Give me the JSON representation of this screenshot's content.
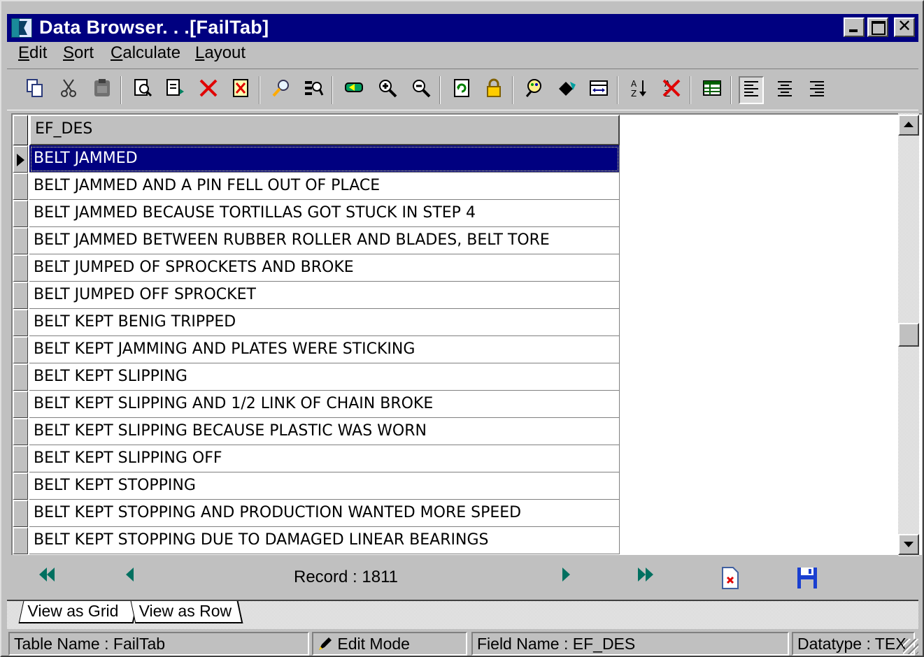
{
  "window": {
    "title": "Data Browser. . .[FailTab]",
    "controls": {
      "minimize": "minimize",
      "maximize": "maximize",
      "close": "✕"
    }
  },
  "menu": [
    {
      "label": "Edit",
      "accel": "E",
      "rest": "dit"
    },
    {
      "label": "Sort",
      "accel": "S",
      "rest": "ort"
    },
    {
      "label": "Calculate",
      "accel": "C",
      "rest": "alculate"
    },
    {
      "label": "Layout",
      "accel": "L",
      "rest": "ayout"
    }
  ],
  "toolbar": {
    "icons": [
      "copy-icon",
      "cut-icon",
      "paste-icon",
      "find-record-icon",
      "edit-record-icon",
      "delete-icon",
      "delete-record-icon",
      "search-icon",
      "find-replace-icon",
      "go-to-icon",
      "zoom-in-icon",
      "zoom-out-icon",
      "refresh-icon",
      "lock-icon",
      "filter-icon",
      "paint-icon",
      "fit-columns-icon",
      "sort-az-icon",
      "clear-sort-icon",
      "grid-lines-icon",
      "align-left-icon",
      "align-center-icon",
      "align-right-icon"
    ],
    "pressed": "align-left-icon"
  },
  "grid": {
    "column_header": "EF_DES",
    "selected_index": 0,
    "rows": [
      "BELT JAMMED",
      "BELT JAMMED AND A PIN FELL OUT OF PLACE",
      "BELT JAMMED BECAUSE TORTILLAS GOT STUCK IN STEP 4",
      "BELT JAMMED BETWEEN RUBBER ROLLER AND BLADES, BELT TORE",
      "BELT JUMPED OF SPROCKETS AND BROKE",
      "BELT JUMPED OFF SPROCKET",
      "BELT KEPT BENIG TRIPPED",
      "BELT KEPT JAMMING AND PLATES WERE STICKING",
      "BELT KEPT SLIPPING",
      "BELT KEPT SLIPPING AND 1/2 LINK OF CHAIN BROKE",
      "BELT KEPT SLIPPING BECAUSE PLASTIC WAS WORN",
      "BELT KEPT SLIPPING OFF",
      "BELT KEPT STOPPING",
      "BELT KEPT STOPPING AND PRODUCTION WANTED MORE SPEED",
      "BELT KEPT STOPPING DUE TO DAMAGED LINEAR BEARINGS"
    ]
  },
  "navigation": {
    "record_label": "Record : 1811"
  },
  "tabs": [
    {
      "label": "View as Grid",
      "active": true
    },
    {
      "label": "View as Row",
      "active": false
    }
  ],
  "status": {
    "table": "Table Name : FailTab",
    "mode": "Edit Mode",
    "field": "Field Name : EF_DES",
    "datatype": "Datatype : TEX"
  },
  "colors": {
    "title_bar": "#000080",
    "selection": "#000080",
    "nav_arrows": "#007060",
    "face": "#c0c0c0"
  }
}
